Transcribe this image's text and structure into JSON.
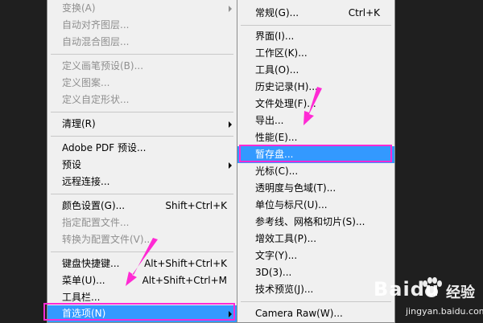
{
  "edit_menu": {
    "items": [
      {
        "label": "变换(A)",
        "shortcut": "",
        "disabled": true,
        "submenu": true
      },
      {
        "label": "自动对齐图层...",
        "shortcut": "",
        "disabled": true
      },
      {
        "label": "自动混合图层...",
        "shortcut": "",
        "disabled": true
      },
      {
        "label": "定义画笔预设(B)...",
        "shortcut": "",
        "disabled": true
      },
      {
        "label": "定义图案...",
        "shortcut": "",
        "disabled": true
      },
      {
        "label": "定义自定形状...",
        "shortcut": "",
        "disabled": true
      },
      {
        "label": "清理(R)",
        "shortcut": "",
        "disabled": false,
        "submenu": true
      },
      {
        "label": "Adobe PDF 预设...",
        "shortcut": "",
        "disabled": false
      },
      {
        "label": "预设",
        "shortcut": "",
        "disabled": false,
        "submenu": true
      },
      {
        "label": "远程连接...",
        "shortcut": "",
        "disabled": false
      },
      {
        "label": "颜色设置(G)...",
        "shortcut": "Shift+Ctrl+K",
        "disabled": false
      },
      {
        "label": "指定配置文件...",
        "shortcut": "",
        "disabled": true
      },
      {
        "label": "转换为配置文件(V)...",
        "shortcut": "",
        "disabled": true
      },
      {
        "label": "键盘快捷键...",
        "shortcut": "Alt+Shift+Ctrl+K",
        "disabled": false
      },
      {
        "label": "菜单(U)...",
        "shortcut": "Alt+Shift+Ctrl+M",
        "disabled": false
      },
      {
        "label": "工具栏...",
        "shortcut": "",
        "disabled": false
      },
      {
        "label": "首选项(N)",
        "shortcut": "",
        "disabled": false,
        "submenu": true,
        "highlighted": true
      }
    ]
  },
  "preferences_menu": {
    "items": [
      {
        "label": "常规(G)...",
        "shortcut": "Ctrl+K"
      },
      {
        "label": "界面(I)...",
        "shortcut": ""
      },
      {
        "label": "工作区(K)...",
        "shortcut": ""
      },
      {
        "label": "工具(O)...",
        "shortcut": ""
      },
      {
        "label": "历史记录(H)...",
        "shortcut": ""
      },
      {
        "label": "文件处理(F)...",
        "shortcut": ""
      },
      {
        "label": "导出...",
        "shortcut": ""
      },
      {
        "label": "性能(E)...",
        "shortcut": ""
      },
      {
        "label": "暂存盘...",
        "shortcut": "",
        "highlighted": true
      },
      {
        "label": "光标(C)...",
        "shortcut": ""
      },
      {
        "label": "透明度与色域(T)...",
        "shortcut": ""
      },
      {
        "label": "单位与标尺(U)...",
        "shortcut": ""
      },
      {
        "label": "参考线、网格和切片(S)...",
        "shortcut": ""
      },
      {
        "label": "增效工具(P)...",
        "shortcut": ""
      },
      {
        "label": "文字(Y)...",
        "shortcut": ""
      },
      {
        "label": "3D(3)...",
        "shortcut": ""
      },
      {
        "label": "技术预览(J)...",
        "shortcut": ""
      },
      {
        "label": "Camera Raw(W)...",
        "shortcut": ""
      }
    ]
  },
  "colors": {
    "menu_bg": "#f0f0f0",
    "highlight": "#3399ff",
    "callout": "#ff2ad4",
    "disabled_text": "#8f8f8f"
  },
  "watermark": {
    "brand": "Baidu",
    "cn": "经验",
    "url": "jingyan.baidu.com"
  }
}
